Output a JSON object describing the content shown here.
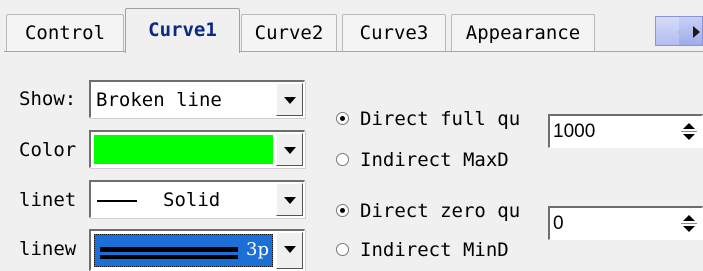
{
  "tabs": [
    {
      "label": "Control",
      "active": false
    },
    {
      "label": "Curve1",
      "active": true
    },
    {
      "label": "Curve2",
      "active": false
    },
    {
      "label": "Curve3",
      "active": false
    },
    {
      "label": "Appearance",
      "active": false
    }
  ],
  "tab_scroll": {
    "left_icon": "arrow-left-icon",
    "right_icon": "arrow-right-icon"
  },
  "fields": {
    "show": {
      "label": "Show:",
      "value": "Broken line"
    },
    "color": {
      "label": "Color",
      "value_color": "#00ff00"
    },
    "linetype": {
      "label": "linet",
      "value": "Solid"
    },
    "linewidth": {
      "label": "linew",
      "value": "3p"
    }
  },
  "max_group": {
    "option1": "Direct full qu",
    "option2": "Indirect MaxD",
    "selected": "option1",
    "spin_value": "1000"
  },
  "min_group": {
    "option1": "Direct zero qu",
    "option2": "Indirect MinD",
    "selected": "option1",
    "spin_value": "0"
  }
}
